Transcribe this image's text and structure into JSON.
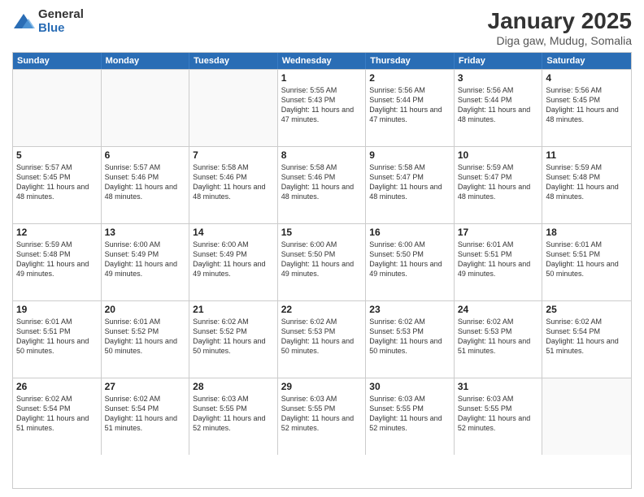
{
  "logo": {
    "general": "General",
    "blue": "Blue"
  },
  "title": "January 2025",
  "location": "Diga gaw, Mudug, Somalia",
  "days_of_week": [
    "Sunday",
    "Monday",
    "Tuesday",
    "Wednesday",
    "Thursday",
    "Friday",
    "Saturday"
  ],
  "weeks": [
    [
      {
        "day": "",
        "empty": true
      },
      {
        "day": "",
        "empty": true
      },
      {
        "day": "",
        "empty": true
      },
      {
        "day": "1",
        "sunrise": "5:55 AM",
        "sunset": "5:43 PM",
        "daylight": "11 hours and 47 minutes."
      },
      {
        "day": "2",
        "sunrise": "5:56 AM",
        "sunset": "5:44 PM",
        "daylight": "11 hours and 47 minutes."
      },
      {
        "day": "3",
        "sunrise": "5:56 AM",
        "sunset": "5:44 PM",
        "daylight": "11 hours and 48 minutes."
      },
      {
        "day": "4",
        "sunrise": "5:56 AM",
        "sunset": "5:45 PM",
        "daylight": "11 hours and 48 minutes."
      }
    ],
    [
      {
        "day": "5",
        "sunrise": "5:57 AM",
        "sunset": "5:45 PM",
        "daylight": "11 hours and 48 minutes."
      },
      {
        "day": "6",
        "sunrise": "5:57 AM",
        "sunset": "5:46 PM",
        "daylight": "11 hours and 48 minutes."
      },
      {
        "day": "7",
        "sunrise": "5:58 AM",
        "sunset": "5:46 PM",
        "daylight": "11 hours and 48 minutes."
      },
      {
        "day": "8",
        "sunrise": "5:58 AM",
        "sunset": "5:46 PM",
        "daylight": "11 hours and 48 minutes."
      },
      {
        "day": "9",
        "sunrise": "5:58 AM",
        "sunset": "5:47 PM",
        "daylight": "11 hours and 48 minutes."
      },
      {
        "day": "10",
        "sunrise": "5:59 AM",
        "sunset": "5:47 PM",
        "daylight": "11 hours and 48 minutes."
      },
      {
        "day": "11",
        "sunrise": "5:59 AM",
        "sunset": "5:48 PM",
        "daylight": "11 hours and 48 minutes."
      }
    ],
    [
      {
        "day": "12",
        "sunrise": "5:59 AM",
        "sunset": "5:48 PM",
        "daylight": "11 hours and 49 minutes."
      },
      {
        "day": "13",
        "sunrise": "6:00 AM",
        "sunset": "5:49 PM",
        "daylight": "11 hours and 49 minutes."
      },
      {
        "day": "14",
        "sunrise": "6:00 AM",
        "sunset": "5:49 PM",
        "daylight": "11 hours and 49 minutes."
      },
      {
        "day": "15",
        "sunrise": "6:00 AM",
        "sunset": "5:50 PM",
        "daylight": "11 hours and 49 minutes."
      },
      {
        "day": "16",
        "sunrise": "6:00 AM",
        "sunset": "5:50 PM",
        "daylight": "11 hours and 49 minutes."
      },
      {
        "day": "17",
        "sunrise": "6:01 AM",
        "sunset": "5:51 PM",
        "daylight": "11 hours and 49 minutes."
      },
      {
        "day": "18",
        "sunrise": "6:01 AM",
        "sunset": "5:51 PM",
        "daylight": "11 hours and 50 minutes."
      }
    ],
    [
      {
        "day": "19",
        "sunrise": "6:01 AM",
        "sunset": "5:51 PM",
        "daylight": "11 hours and 50 minutes."
      },
      {
        "day": "20",
        "sunrise": "6:01 AM",
        "sunset": "5:52 PM",
        "daylight": "11 hours and 50 minutes."
      },
      {
        "day": "21",
        "sunrise": "6:02 AM",
        "sunset": "5:52 PM",
        "daylight": "11 hours and 50 minutes."
      },
      {
        "day": "22",
        "sunrise": "6:02 AM",
        "sunset": "5:53 PM",
        "daylight": "11 hours and 50 minutes."
      },
      {
        "day": "23",
        "sunrise": "6:02 AM",
        "sunset": "5:53 PM",
        "daylight": "11 hours and 50 minutes."
      },
      {
        "day": "24",
        "sunrise": "6:02 AM",
        "sunset": "5:53 PM",
        "daylight": "11 hours and 51 minutes."
      },
      {
        "day": "25",
        "sunrise": "6:02 AM",
        "sunset": "5:54 PM",
        "daylight": "11 hours and 51 minutes."
      }
    ],
    [
      {
        "day": "26",
        "sunrise": "6:02 AM",
        "sunset": "5:54 PM",
        "daylight": "11 hours and 51 minutes."
      },
      {
        "day": "27",
        "sunrise": "6:02 AM",
        "sunset": "5:54 PM",
        "daylight": "11 hours and 51 minutes."
      },
      {
        "day": "28",
        "sunrise": "6:03 AM",
        "sunset": "5:55 PM",
        "daylight": "11 hours and 52 minutes."
      },
      {
        "day": "29",
        "sunrise": "6:03 AM",
        "sunset": "5:55 PM",
        "daylight": "11 hours and 52 minutes."
      },
      {
        "day": "30",
        "sunrise": "6:03 AM",
        "sunset": "5:55 PM",
        "daylight": "11 hours and 52 minutes."
      },
      {
        "day": "31",
        "sunrise": "6:03 AM",
        "sunset": "5:55 PM",
        "daylight": "11 hours and 52 minutes."
      },
      {
        "day": "",
        "empty": true
      }
    ]
  ]
}
